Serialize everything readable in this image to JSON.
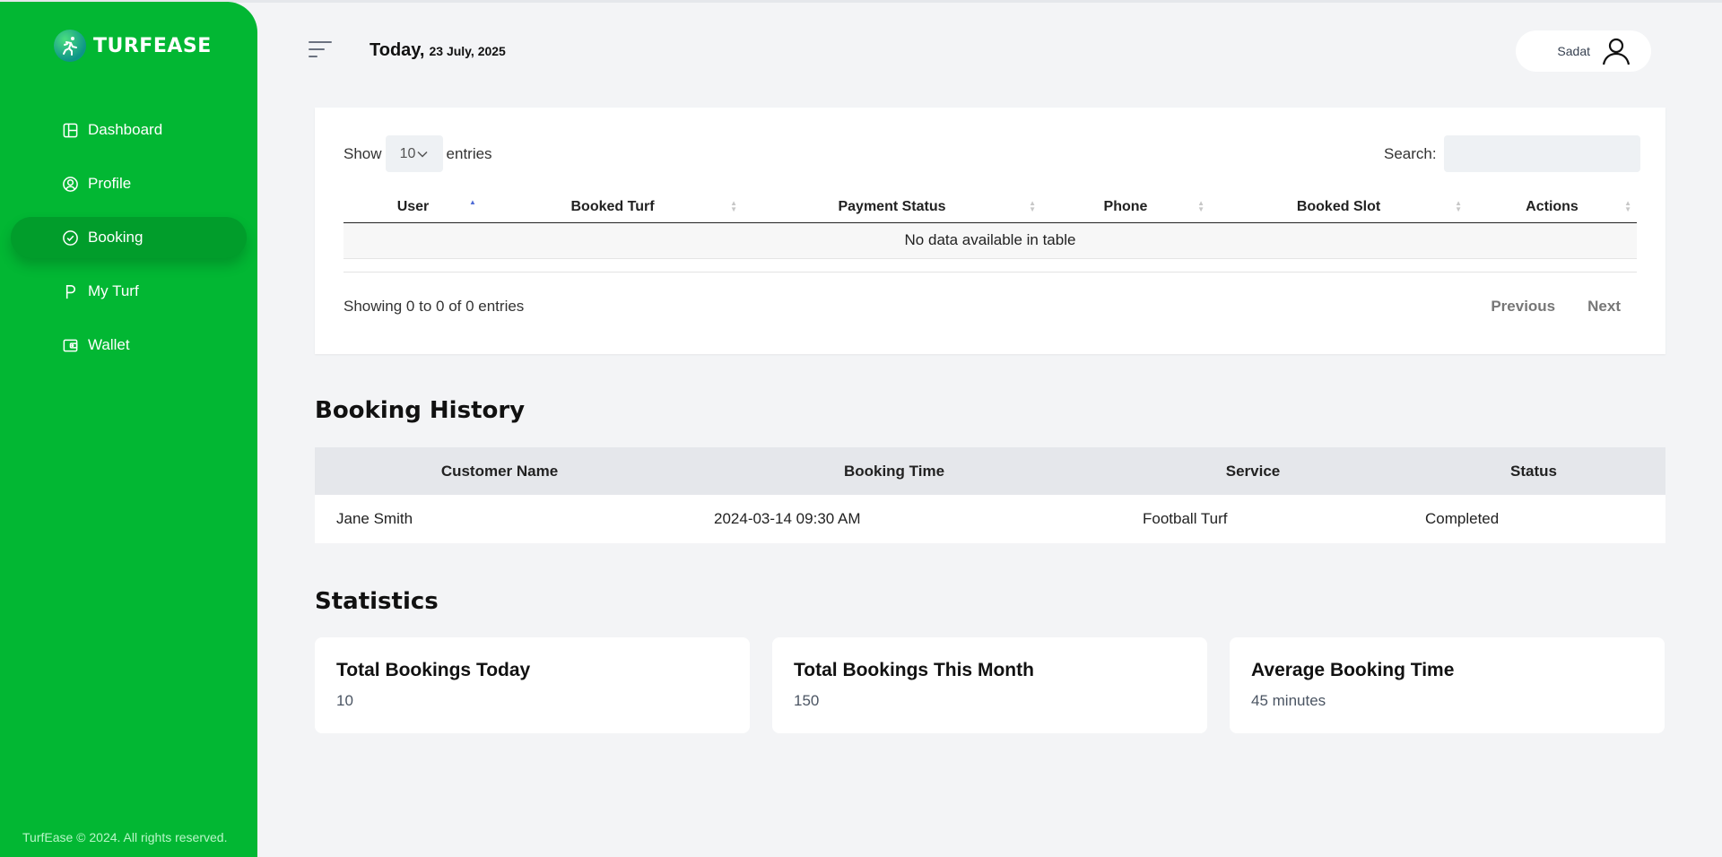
{
  "brand": {
    "name": "TURFEASE"
  },
  "sidebar": {
    "items": [
      {
        "label": "Dashboard",
        "icon": "layout-icon",
        "active": false
      },
      {
        "label": "Profile",
        "icon": "user-circle-icon",
        "active": false
      },
      {
        "label": "Booking",
        "icon": "check-circle-icon",
        "active": true
      },
      {
        "label": "My Turf",
        "icon": "parking-icon",
        "active": false
      },
      {
        "label": "Wallet",
        "icon": "wallet-icon",
        "active": false
      }
    ],
    "footer": "TurfEase © 2024. All rights reserved."
  },
  "header": {
    "today_label": "Today,",
    "date": "23 July, 2025",
    "user_name": "Sadat"
  },
  "datatable": {
    "show_label": "Show",
    "entries_label": "entries",
    "page_length": "10",
    "search_label": "Search:",
    "search_value": "",
    "columns": [
      "User",
      "Booked Turf",
      "Payment Status",
      "Phone",
      "Booked Slot",
      "Actions"
    ],
    "empty_message": "No data available in table",
    "info": "Showing 0 to 0 of 0 entries",
    "prev_label": "Previous",
    "next_label": "Next"
  },
  "history": {
    "title": "Booking History",
    "columns": [
      "Customer Name",
      "Booking Time",
      "Service",
      "Status"
    ],
    "rows": [
      [
        "Jane Smith",
        "2024-03-14 09:30 AM",
        "Football Turf",
        "Completed"
      ]
    ]
  },
  "statistics": {
    "title": "Statistics",
    "cards": [
      {
        "title": "Total Bookings Today",
        "value": "10"
      },
      {
        "title": "Total Bookings This Month",
        "value": "150"
      },
      {
        "title": "Average Booking Time",
        "value": "45 minutes"
      }
    ]
  },
  "colors": {
    "sidebar_bg": "#02b733",
    "sidebar_active": "#019d2b",
    "page_bg": "#f3f4f6",
    "sort_active": "#4f6bd6"
  }
}
